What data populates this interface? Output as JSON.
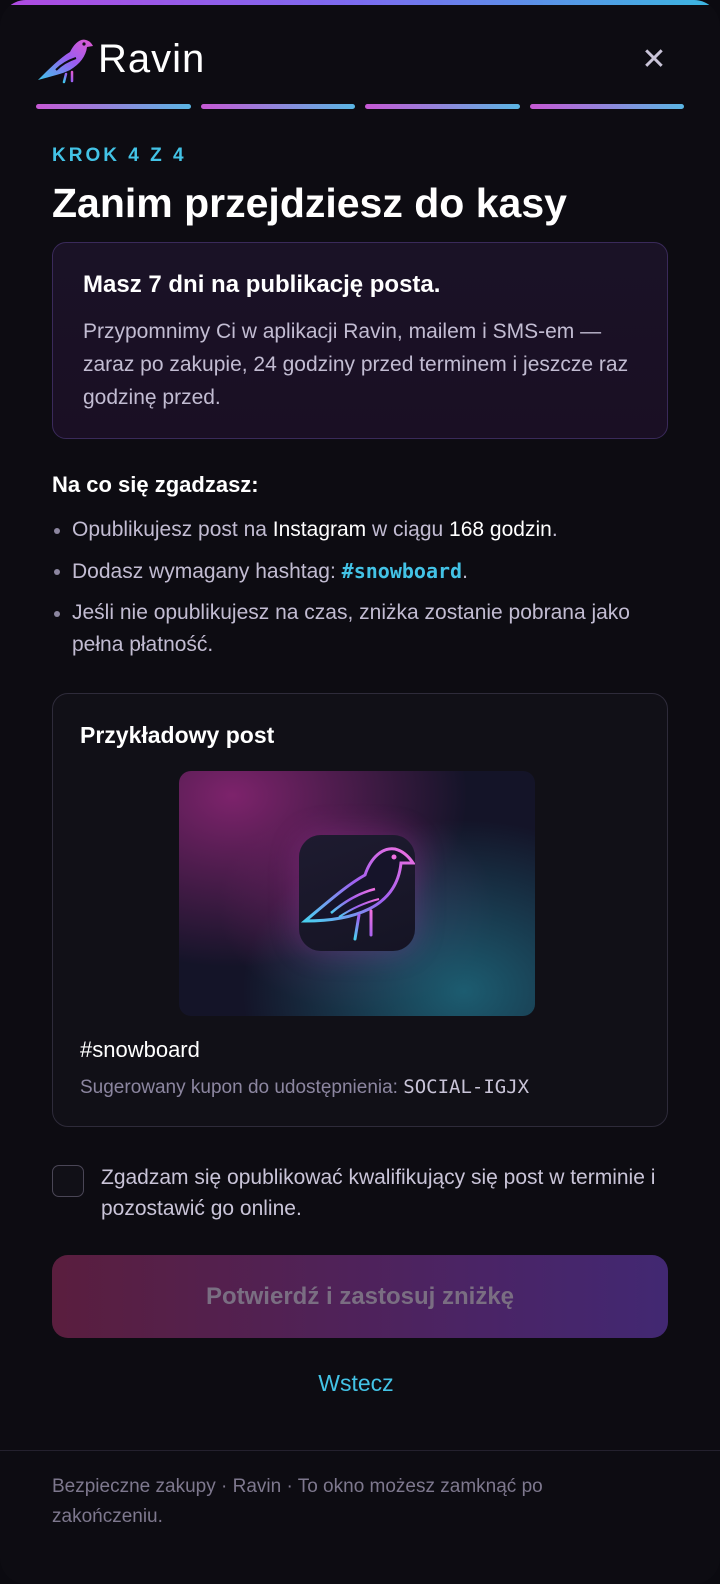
{
  "header": {
    "brand": "Ravin",
    "close_symbol": "✕",
    "logo_icon": "raven-icon",
    "close_icon": "close-icon"
  },
  "progress": {
    "total_steps": 4,
    "completed_steps": 4
  },
  "step": {
    "label": "KROK 4 Z 4"
  },
  "title": "Zanim przejdziesz do kasy",
  "info_card": {
    "heading": "Masz 7 dni na publikację posta.",
    "body": "Przypomnimy Ci w aplikacji Ravin, mailem i SMS-em — zaraz po zakupie, 24 godziny przed terminem i jeszcze raz godzinę przed."
  },
  "agreement": {
    "heading": "Na co się zgadzasz:",
    "item1": {
      "prefix": "Opublikujesz post na ",
      "platform": "Instagram",
      "middle": " w ciągu ",
      "hours": "168 godzin",
      "suffix": "."
    },
    "item2": {
      "prefix": "Dodasz wymagany hashtag: ",
      "hashtag": "#snowboard",
      "suffix": "."
    },
    "item3": {
      "text": "Jeśli nie opublikujesz na czas, zniżka zostanie pobrana jako pełna płatność."
    }
  },
  "sample_post": {
    "heading": "Przykładowy post",
    "hashtag": "#snowboard",
    "coupon_label": "Sugerowany kupon do udostępnienia: ",
    "coupon_code": "SOCIAL-IGJX"
  },
  "consent": {
    "checked": false,
    "text": "Zgadzam się opublikować kwalifikujący się post w terminie i pozostawić go online."
  },
  "actions": {
    "confirm_label": "Potwierdź i zastosuj zniżkę",
    "confirm_disabled": true,
    "back_label": "Wstecz"
  },
  "footer": {
    "text": "Bezpieczne zakupy · Ravin · To okno możesz zamknąć po zakończeniu."
  },
  "colors": {
    "accent_cyan": "#43c3e6",
    "background": "#0d0c12",
    "gradient_pink": "#c658d4",
    "gradient_blue": "#5ab6e4"
  }
}
